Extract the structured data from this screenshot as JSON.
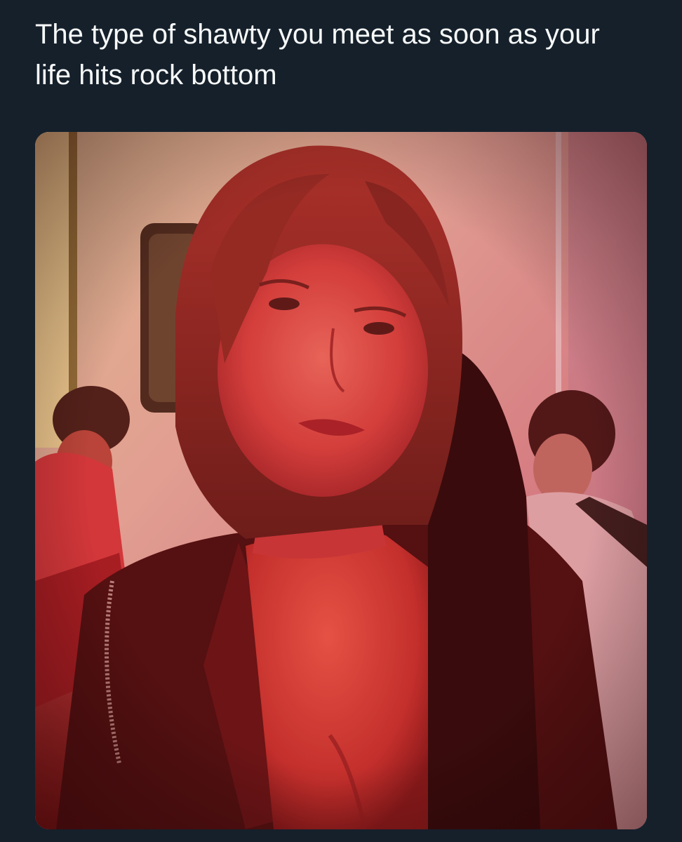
{
  "post": {
    "caption": "The type of shawty you meet as soon as your life hits rock bottom"
  },
  "colors": {
    "background": "#15202b",
    "text": "#f7f9f9",
    "photo_tint": "#c02a2e"
  }
}
